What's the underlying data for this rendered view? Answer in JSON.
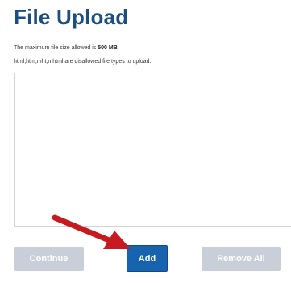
{
  "page": {
    "title": "File Upload",
    "max_size_prefix": "The maximum file size allowed is ",
    "max_size_value": "500 MB",
    "max_size_suffix": ".",
    "disallowed_types": "html;htm;mht;mhtml are disallowed file types to upload."
  },
  "buttons": {
    "continue": "Continue",
    "add": "Add",
    "remove_all": "Remove All"
  },
  "colors": {
    "title": "#1c4f80",
    "add_button": "#1763ad",
    "disabled_button": "#c8cfd8",
    "arrow": "#c8191e"
  },
  "icons": {
    "pointer": "arrow-pointer-icon"
  }
}
